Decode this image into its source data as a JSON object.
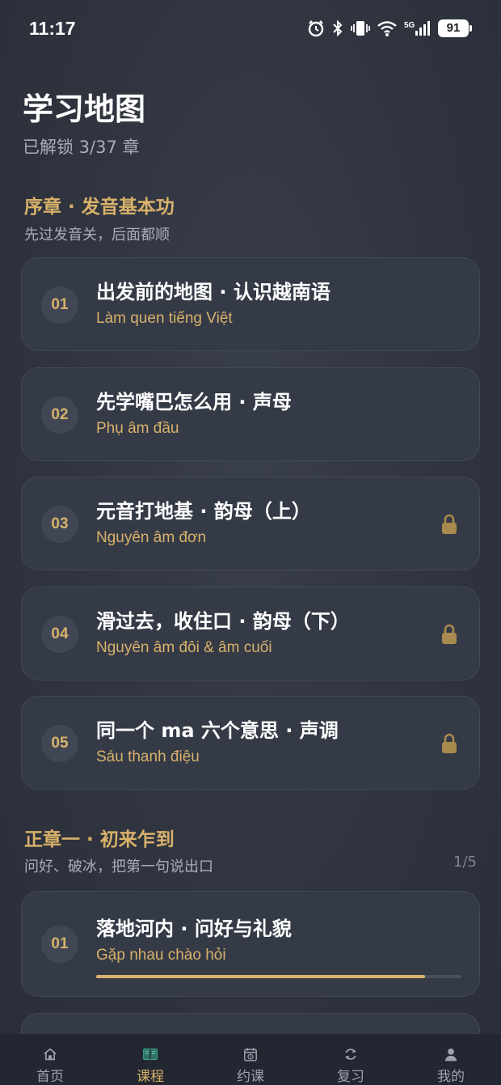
{
  "status_bar": {
    "time": "11:17",
    "battery": "91",
    "network": "5G"
  },
  "header": {
    "title": "学习地图",
    "subtitle": "已解锁 3/37 章"
  },
  "sections": [
    {
      "title": "序章 · 发音基本功",
      "desc": "先过发音关，后面都顺",
      "lessons": [
        {
          "num": "01",
          "title": "出发前的地图 · 认识越南语",
          "sub": "Làm quen tiếng Việt",
          "locked": false
        },
        {
          "num": "02",
          "title": "先学嘴巴怎么用 · 声母",
          "sub": "Phụ âm đầu",
          "locked": false
        },
        {
          "num": "03",
          "title": "元音打地基 · 韵母（上）",
          "sub": "Nguyên âm đơn",
          "locked": true
        },
        {
          "num": "04",
          "title": "滑过去，收住口 · 韵母（下）",
          "sub": "Nguyên âm đôi & âm cuối",
          "locked": true
        },
        {
          "num": "05",
          "title": "同一个 ma 六个意思 · 声调",
          "sub": "Sáu thanh điệu",
          "locked": true
        }
      ]
    },
    {
      "title": "正章一 · 初来乍到",
      "desc": "问好、破冰，把第一句说出口",
      "count": "1/5",
      "lessons": [
        {
          "num": "01",
          "title": "落地河内 · 问好与礼貌",
          "sub": "Gặp nhau chào hỏi",
          "locked": false,
          "progress": 0.9
        }
      ]
    }
  ],
  "bottom_nav": [
    {
      "label": "首页",
      "icon": "home-icon",
      "active": false
    },
    {
      "label": "课程",
      "icon": "book-icon",
      "active": true
    },
    {
      "label": "约课",
      "icon": "calendar-icon",
      "active": false
    },
    {
      "label": "复习",
      "icon": "refresh-icon",
      "active": false
    },
    {
      "label": "我的",
      "icon": "user-icon",
      "active": false
    }
  ],
  "colors": {
    "accent": "#d8b26a",
    "background": "#30343f",
    "card": "#353a47",
    "nav": "#232731"
  }
}
